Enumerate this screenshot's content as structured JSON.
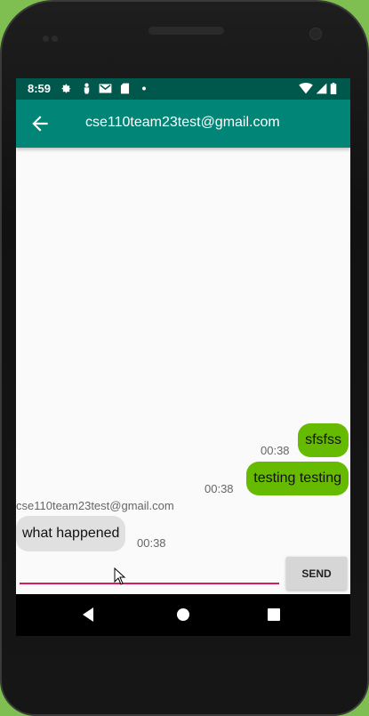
{
  "status_bar": {
    "time": "8:59",
    "icons": [
      "settings-icon",
      "person-icon",
      "gmail-icon",
      "sd-card-icon",
      "dot-icon"
    ],
    "right_icons": [
      "wifi-icon",
      "signal-icon",
      "battery-icon"
    ],
    "color": "#00574b"
  },
  "app_bar": {
    "title": "cse110team23test@gmail.com",
    "back_icon": "arrow-back-icon",
    "color": "#008577"
  },
  "messages": [
    {
      "direction": "sent",
      "text": "sfsfss",
      "time": "00:38"
    },
    {
      "direction": "sent",
      "text": "testing testing",
      "time": "00:38"
    },
    {
      "direction": "received",
      "sender": "cse110team23test@gmail.com",
      "text": "what happened",
      "time": "00:38"
    }
  ],
  "composer": {
    "input_value": "",
    "send_label": "SEND",
    "accent": "#d81b60"
  },
  "colors": {
    "sent_bubble": "#66bb00",
    "received_bubble": "#e0e0e0"
  },
  "nav_bar": {
    "icons": [
      "back-triangle-icon",
      "home-circle-icon",
      "recents-square-icon"
    ]
  }
}
